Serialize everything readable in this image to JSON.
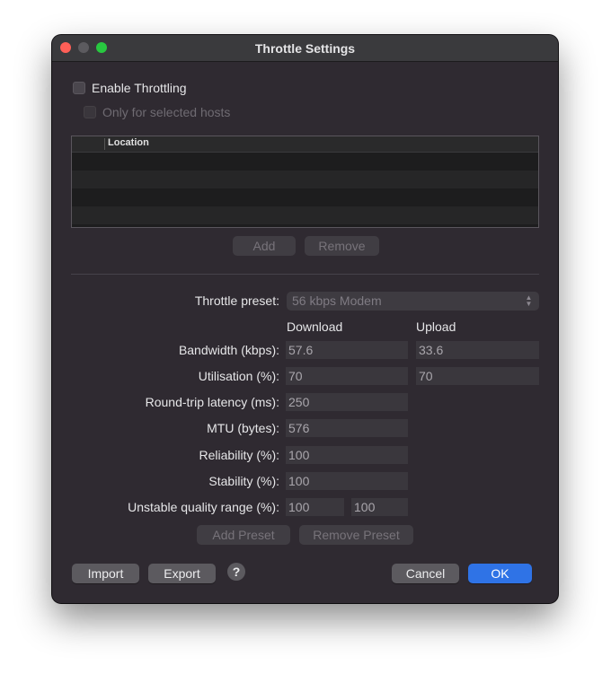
{
  "window": {
    "title": "Throttle Settings"
  },
  "enable_throttling": {
    "label": "Enable Throttling",
    "checked": false
  },
  "only_selected_hosts": {
    "label": "Only for selected hosts",
    "checked": false,
    "enabled": false
  },
  "hosts_table": {
    "column_header": "Location",
    "rows": []
  },
  "host_buttons": {
    "add": "Add",
    "remove": "Remove"
  },
  "preset": {
    "label": "Throttle preset:",
    "value": "56 kbps Modem"
  },
  "columns": {
    "download": "Download",
    "upload": "Upload"
  },
  "settings": {
    "bandwidth": {
      "label": "Bandwidth (kbps):",
      "download": "57.6",
      "upload": "33.6"
    },
    "utilisation": {
      "label": "Utilisation (%):",
      "download": "70",
      "upload": "70"
    },
    "latency": {
      "label": "Round-trip latency (ms):",
      "value": "250"
    },
    "mtu": {
      "label": "MTU (bytes):",
      "value": "576"
    },
    "reliability": {
      "label": "Reliability (%):",
      "value": "100"
    },
    "stability": {
      "label": "Stability (%):",
      "value": "100"
    },
    "unstable_range": {
      "label": "Unstable quality range (%):",
      "min": "100",
      "max": "100"
    }
  },
  "preset_buttons": {
    "add": "Add Preset",
    "remove": "Remove Preset"
  },
  "footer": {
    "import": "Import",
    "export": "Export",
    "help": "?",
    "cancel": "Cancel",
    "ok": "OK"
  },
  "colors": {
    "accent": "#2f73e6",
    "window_bg": "#2f2a31",
    "close": "#ff5f57",
    "zoom": "#28c840"
  }
}
